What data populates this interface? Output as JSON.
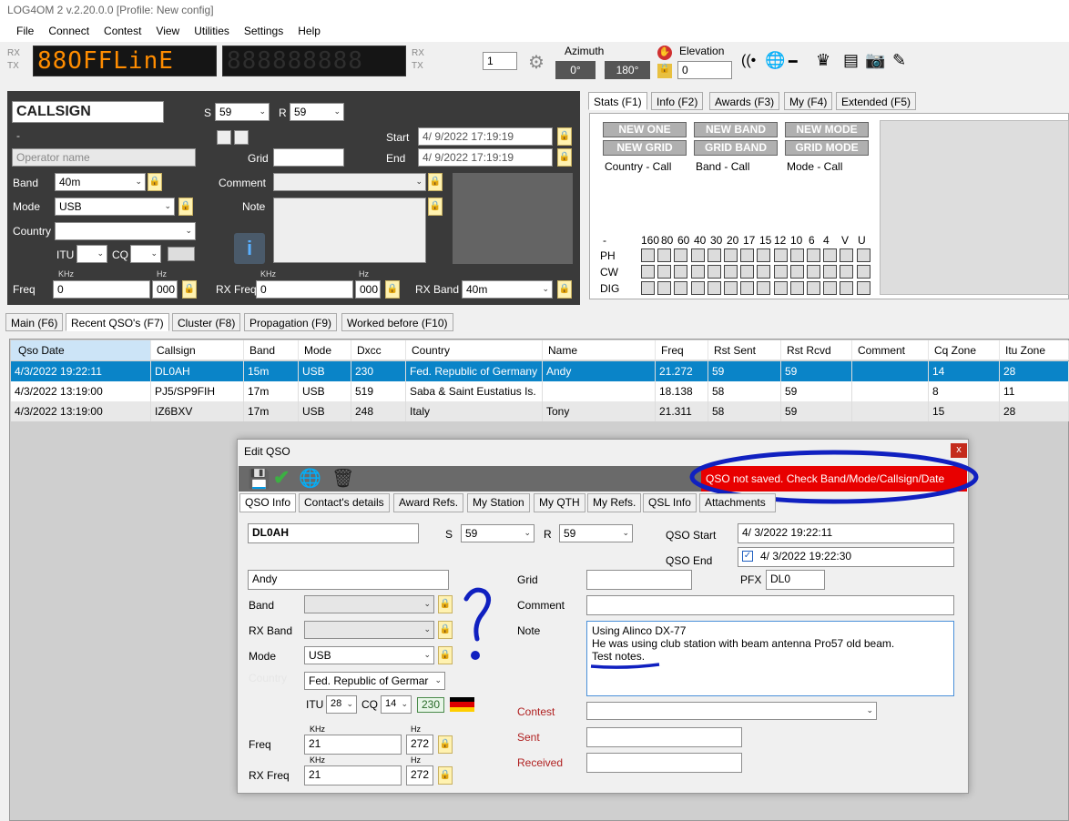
{
  "window_title": "LOG4OM 2 v.2.20.0.0 [Profile: New config]",
  "menu": [
    "File",
    "Connect",
    "Contest",
    "View",
    "Utilities",
    "Settings",
    "Help"
  ],
  "toolbar": {
    "rx": "RX",
    "tx": "TX",
    "status_text": "88OFFLinE",
    "freq_display": "888888888",
    "step": "1",
    "azimuth_label": "Azimuth",
    "az_left": "0°",
    "az_right": "180°",
    "elevation_label": "Elevation",
    "elevation": "0",
    "led_color": "#ff8c00"
  },
  "entry": {
    "callsign_placeholder": "CALLSIGN",
    "dash": "-",
    "operator_placeholder": "Operator name",
    "s_label": "S",
    "s_value": "59",
    "r_label": "R",
    "r_value": "59",
    "start_label": "Start",
    "start_value": "4/  9/2022 17:19:19",
    "end_label": "End",
    "end_value": "4/  9/2022 17:19:19",
    "grid_label": "Grid",
    "band_label": "Band",
    "band_value": "40m",
    "comment_label": "Comment",
    "mode_label": "Mode",
    "mode_value": "USB",
    "note_label": "Note",
    "country_label": "Country",
    "itu_label": "ITU",
    "cq_label": "CQ",
    "khz": "KHz",
    "hz": "Hz",
    "freq_label": "Freq",
    "freq_khz": "0",
    "freq_hz": "000",
    "rxfreq_label": "RX Freq",
    "rxfreq_khz": "0",
    "rxfreq_hz": "000",
    "rxband_label": "RX Band",
    "rxband_value": "40m"
  },
  "stats_tabs": [
    "Stats (F1)",
    "Info (F2)",
    "Awards (F3)",
    "My (F4)",
    "Extended (F5)"
  ],
  "stats": {
    "buttons": [
      "NEW ONE",
      "NEW BAND",
      "NEW MODE",
      "NEW GRID",
      "GRID BAND",
      "GRID MODE"
    ],
    "labels": [
      "Country - Call",
      "Band - Call",
      "Mode - Call"
    ],
    "dash": "-",
    "bands": [
      "160",
      "80",
      "60",
      "40",
      "30",
      "20",
      "17",
      "15",
      "12",
      "10",
      "6",
      "4",
      "V",
      "U"
    ],
    "modes": [
      "PH",
      "CW",
      "DIG"
    ]
  },
  "main_tabs": [
    "Main (F6)",
    "Recent QSO's (F7)",
    "Cluster (F8)",
    "Propagation (F9)",
    "Worked before (F10)"
  ],
  "table": {
    "columns": [
      "Qso Date",
      "Callsign",
      "Band",
      "Mode",
      "Dxcc",
      "Country",
      "Name",
      "Freq",
      "Rst Sent",
      "Rst Rcvd",
      "Comment",
      "Cq Zone",
      "Itu Zone"
    ],
    "rows": [
      [
        "4/3/2022 19:22:11",
        "DL0AH",
        "15m",
        "USB",
        "230",
        "Fed. Republic of Germany",
        "Andy",
        "21.272",
        "59",
        "59",
        "",
        "14",
        "28"
      ],
      [
        "4/3/2022 13:19:00",
        "PJ5/SP9FIH",
        "17m",
        "USB",
        "519",
        "Saba & Saint Eustatius Is.",
        "",
        "18.138",
        "58",
        "59",
        "",
        "8",
        "11"
      ],
      [
        "4/3/2022 13:19:00",
        "IZ6BXV",
        "17m",
        "USB",
        "248",
        "Italy",
        "Tony",
        "21.311",
        "58",
        "59",
        "",
        "15",
        "28"
      ]
    ]
  },
  "dialog": {
    "title": "Edit QSO",
    "close": "x",
    "error": "QSO not saved. Check Band/Mode/Callsign/Date",
    "tabs": [
      "QSO Info",
      "Contact's details",
      "Award Refs.",
      "My Station",
      "My QTH",
      "My Refs.",
      "QSL Info",
      "Attachments"
    ],
    "callsign": "DL0AH",
    "s_label": "S",
    "s_value": "59",
    "r_label": "R",
    "r_value": "59",
    "qso_start_label": "QSO Start",
    "qso_start": "4/  3/2022 19:22:11",
    "qso_end_label": "QSO End",
    "qso_end": "4/  3/2022 19:22:30",
    "name": "Andy",
    "grid_label": "Grid",
    "pfx_label": "PFX",
    "pfx": "DL0",
    "band_label": "Band",
    "comment_label": "Comment",
    "rxband_label": "RX Band",
    "note_label": "Note",
    "note_lines": [
      "Using Alinco DX-77",
      "He was using club station with beam antenna Pro57 old beam.",
      "Test notes."
    ],
    "mode_label": "Mode",
    "mode_value": "USB",
    "country_label": "Country",
    "country_value": "Fed. Republic of Germar",
    "itu_label": "ITU",
    "itu_value": "28",
    "cq_label": "CQ",
    "cq_value": "14",
    "dxcc": "230",
    "contest_label": "Contest",
    "sent_label": "Sent",
    "received_label": "Received",
    "khz": "KHz",
    "hz": "Hz",
    "freq_label": "Freq",
    "freq_khz": "21",
    "freq_hz": "272",
    "rxfreq_label": "RX Freq",
    "rxfreq_khz": "21",
    "rxfreq_hz": "272"
  },
  "colors": {
    "selection": "#0a84c8",
    "error": "#e00000",
    "annotation": "#1020c0"
  }
}
